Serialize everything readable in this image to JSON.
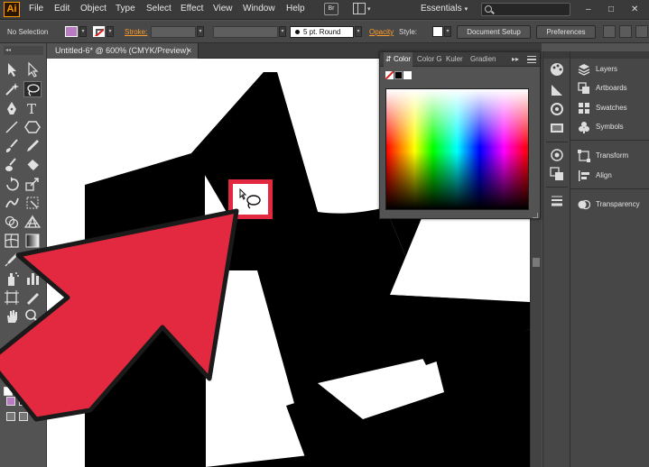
{
  "app": {
    "logo": "Ai",
    "menus": [
      "File",
      "Edit",
      "Object",
      "Type",
      "Select",
      "Effect",
      "View",
      "Window",
      "Help"
    ],
    "bridge_label": "Br",
    "workspace": "Essentials",
    "search_placeholder": "",
    "window_controls": [
      "–",
      "□",
      "✕"
    ]
  },
  "control_bar": {
    "selection_status": "No Selection",
    "stroke_label": "Stroke:",
    "brush_label": "5 pt. Round",
    "opacity_label": "Opacity",
    "style_label": "Style:",
    "document_setup_label": "Document Setup",
    "preferences_label": "Preferences",
    "fill_color": "#b97cc3"
  },
  "document": {
    "tab_title": "Untitled-6* @ 600% (CMYK/Preview)",
    "close_glyph": "×"
  },
  "color_panel": {
    "tabs": [
      "Color",
      "Color G",
      "Kuler",
      "Gradien"
    ],
    "active_tab": "Color",
    "overflow_glyph": "▸▸"
  },
  "right_panels": {
    "items": [
      "Layers",
      "Artboards",
      "Swatches",
      "Symbols",
      "Transform",
      "Align",
      "Transparency"
    ]
  },
  "toolbar": {
    "grip_glyph": "◂◂",
    "fill_color": "#b97cc3",
    "stroke_state": "none"
  },
  "colors": {
    "accent_orange": "#ff9c2a",
    "callout_red": "#e3293f",
    "ui_dark": "#535353"
  }
}
